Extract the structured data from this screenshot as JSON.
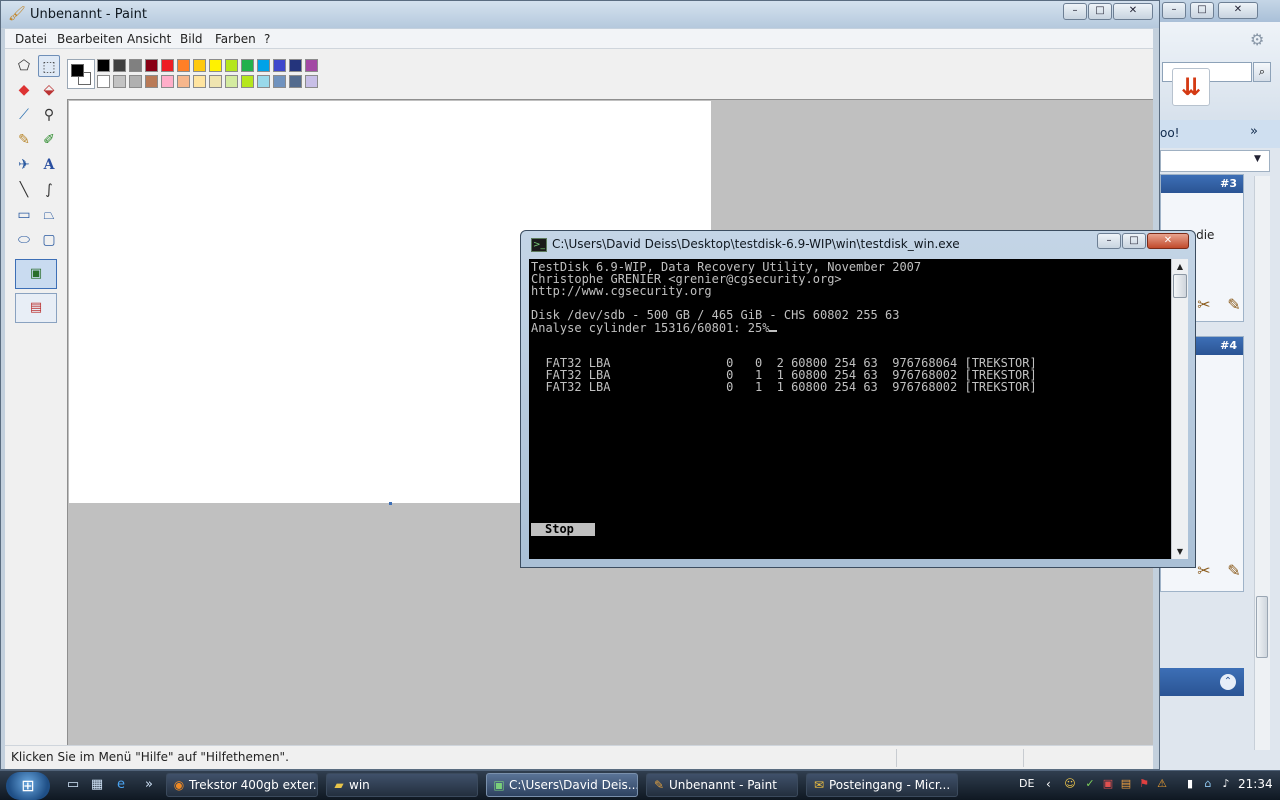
{
  "browser": {
    "strip_text": "oo!",
    "strip_arrow": "»",
    "pane1_badge": "#3",
    "pane1_text": "ar die",
    "pane2_badge": "#4",
    "panel_icon": "chevron-up-icon"
  },
  "paint": {
    "title": "Unbenannt - Paint",
    "menu": [
      "Datei",
      "Bearbeiten",
      "Ansicht",
      "Bild",
      "Farben",
      "?"
    ],
    "status": "Klicken Sie im Menü \"Hilfe\" auf \"Hilfethemen\".",
    "colors": {
      "row1": [
        "#000000",
        "#404040",
        "#808080",
        "#880015",
        "#ed1c24",
        "#ff7f27",
        "#ffc90e",
        "#fff200",
        "#b5e61d",
        "#22b14c",
        "#00a2e8",
        "#3f48cc",
        "#24347c",
        "#a349a4"
      ],
      "row2": [
        "#ffffff",
        "#c3c3c3",
        "#b0b0b0",
        "#b97a57",
        "#ffaec9",
        "#f6b68c",
        "#ffe4a0",
        "#efe4b0",
        "#d4eba0",
        "#b5e61d",
        "#99d9ea",
        "#7092be",
        "#536b8e",
        "#c8bfe7"
      ],
      "foreground": "#000000",
      "background": "#ffffff"
    },
    "tools": [
      "free-select-icon",
      "rect-select-icon",
      "eraser-icon",
      "fill-icon",
      "color-picker-icon",
      "magnifier-icon",
      "pencil-icon",
      "brush-icon",
      "airbrush-icon",
      "text-icon",
      "line-icon",
      "curve-icon",
      "rectangle-icon",
      "polygon-icon",
      "ellipse-icon",
      "rounded-rect-icon"
    ]
  },
  "console": {
    "title": "C:\\Users\\David Deiss\\Desktop\\testdisk-6.9-WIP\\win\\testdisk_win.exe",
    "lines": [
      "TestDisk 6.9-WIP, Data Recovery Utility, November 2007",
      "Christophe GRENIER <grenier@cgsecurity.org>",
      "http://www.cgsecurity.org",
      "",
      "Disk /dev/sdb - 500 GB / 465 GiB - CHS 60802 255 63",
      "Analyse cylinder 15316/60801: 25%",
      "",
      "",
      "  FAT32 LBA                0   0  2 60800 254 63  976768064 [TREKSTOR]",
      "  FAT32 LBA                0   1  1 60800 254 63  976768002 [TREKSTOR]",
      "  FAT32 LBA                0   1  1 60800 254 63  976768002 [TREKSTOR]"
    ],
    "stop_label": "Stop"
  },
  "taskbar": {
    "tasks": [
      {
        "label": "Trekstor 400gb exter...",
        "icon": "firefox-icon"
      },
      {
        "label": "win",
        "icon": "folder-icon"
      },
      {
        "label": "C:\\Users\\David Deis...",
        "icon": "console-icon"
      },
      {
        "label": "Unbenannt - Paint",
        "icon": "paint-icon"
      },
      {
        "label": "Posteingang - Micr...",
        "icon": "outlook-icon"
      }
    ],
    "language": "DE",
    "clock": "21:34"
  }
}
